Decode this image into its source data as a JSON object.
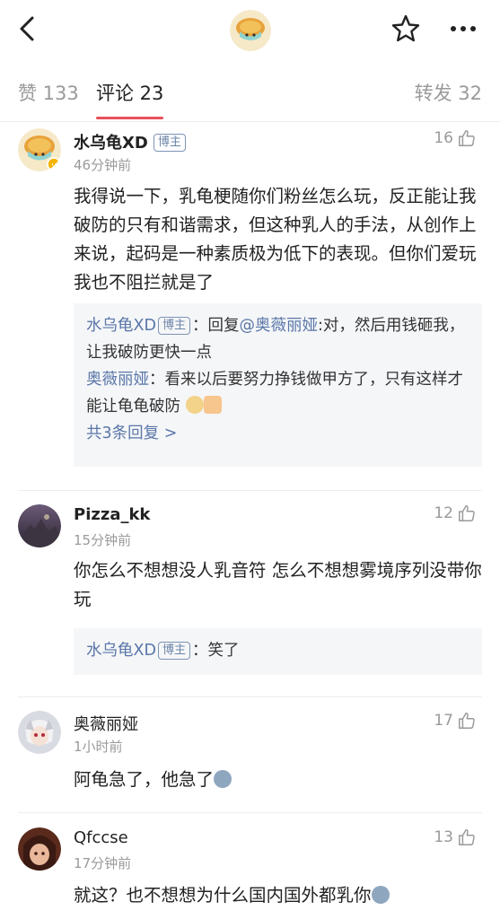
{
  "header": {
    "back_icon": "chevron-left-icon",
    "avatar_icon": "turtle-avatar-icon",
    "star_icon": "star-outline-icon",
    "more_icon": "more-horizontal-icon"
  },
  "tabs": {
    "likes": "赞 133",
    "comments": "评论 23",
    "reposts": "转发 32",
    "active_color": "#e8505b"
  },
  "comments": [
    {
      "name": "水乌龟XD",
      "badge": "博主",
      "time": "46分钟前",
      "likes": "16",
      "text": "我得说一下，乳龟梗随你们粉丝怎么玩，反正能让我破防的只有和谐需求，但这种乳人的手法，从创作上来说，起码是一种素质极为低下的表现。但你们爱玩 我也不阻拦就是了",
      "replies": [
        {
          "name": "水乌龟XD",
          "badge": "博主",
          "prefix": "：回复",
          "mention": "@奥薇丽娅",
          "text": ":对，然后用钱砸我，让我破防更快一点"
        },
        {
          "name": "奥薇丽娅",
          "text": "：看来以后要努力挣钱做甲方了，只有这样才能让龟龟破防"
        }
      ],
      "more_replies": "共3条回复 >"
    },
    {
      "name": "Pizza_kk",
      "time": "15分钟前",
      "likes": "12",
      "text": "你怎么不想想没人乳音符 怎么不想想雾境序列没带你玩",
      "replies": [
        {
          "name": "水乌龟XD",
          "badge": "博主",
          "text": "：笑了"
        }
      ]
    },
    {
      "name": "奥薇丽娅",
      "time": "1小时前",
      "likes": "17",
      "text": "阿龟急了，他急了"
    },
    {
      "name": "Qfccse",
      "time": "17分钟前",
      "likes": "13",
      "text": "就这？也不想想为什么国内国外都乳你"
    }
  ]
}
